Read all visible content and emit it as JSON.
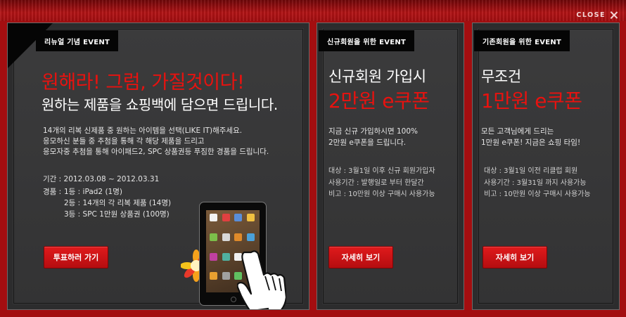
{
  "close": {
    "label": "CLOSE"
  },
  "panel1": {
    "badge": "리뉴얼 기념 EVENT",
    "headline_red": "원해라! 그럼, 가질것이다!",
    "headline_white": "원하는 제품을 쇼핑백에 담으면 드립니다.",
    "desc": [
      "14개의 리복 신제품 중 원하는 아이템을 선택(LIKE IT)해주세요.",
      "응모하신 분들 중 추첨을 통해 각 해당 제품을 드리고",
      "응모자중 추첨을 통해 아이패드2, SPC 상품권등 푸짐한 경품을 드립니다."
    ],
    "period": "기간 : 2012.03.08 ~ 2012.03.31",
    "prizes_label": "경품 :",
    "prizes": [
      "1등 : iPad2 (1명)",
      "2등 : 14개의 각 리복 제품 (14명)",
      "3등 : SPC 1만원 상품권 (100명)"
    ],
    "button": "투표하러 가기"
  },
  "panel2": {
    "badge": "신규회원을 위한 EVENT",
    "headline_white": "신규회원 가입시",
    "headline_red": "2만원 e쿠폰",
    "desc": [
      "지금 신규 가입하시면 100%",
      "2만원 e쿠폰을 드립니다."
    ],
    "details": [
      "대상 : 3월1일 이후 신규 회원가입자",
      "사용기간 : 발행일로 부터 한달간",
      "비고 : 10만원 이상 구매시 사용가능"
    ],
    "button": "자세히 보기"
  },
  "panel3": {
    "badge": "기존회원을 위한 EVENT",
    "headline_white": "무조건",
    "headline_red": "1만원 e쿠폰",
    "desc": [
      "모든 고객님에게 드리는",
      "1만원 e쿠폰! 지금은 쇼핑 타임!"
    ],
    "details": [
      "대상 : 3월1일 이전 리클럽 회원",
      "사용기간 : 3월31일 까지 사용가능",
      "비고 : 10만원 이상 구매시 사용가능"
    ],
    "button": "자세히 보기"
  },
  "colors": {
    "accent_red": "#e8120f",
    "panel_bg": "#333334",
    "frame_red": "#a30e10"
  }
}
